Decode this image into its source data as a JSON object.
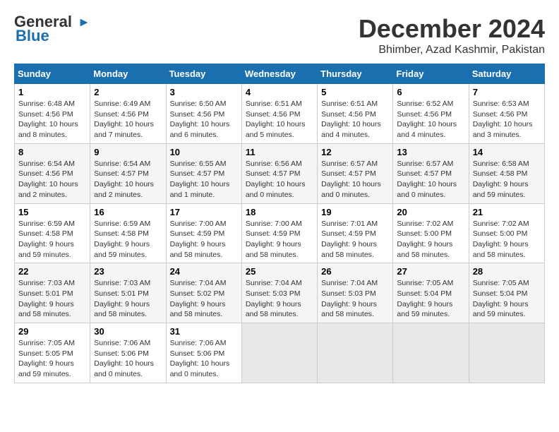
{
  "logo": {
    "line1": "General",
    "line2": "Blue"
  },
  "title": {
    "month": "December 2024",
    "location": "Bhimber, Azad Kashmir, Pakistan"
  },
  "weekdays": [
    "Sunday",
    "Monday",
    "Tuesday",
    "Wednesday",
    "Thursday",
    "Friday",
    "Saturday"
  ],
  "weeks": [
    [
      {
        "day": "1",
        "sunrise": "6:48 AM",
        "sunset": "4:56 PM",
        "daylight": "10 hours and 8 minutes."
      },
      {
        "day": "2",
        "sunrise": "6:49 AM",
        "sunset": "4:56 PM",
        "daylight": "10 hours and 7 minutes."
      },
      {
        "day": "3",
        "sunrise": "6:50 AM",
        "sunset": "4:56 PM",
        "daylight": "10 hours and 6 minutes."
      },
      {
        "day": "4",
        "sunrise": "6:51 AM",
        "sunset": "4:56 PM",
        "daylight": "10 hours and 5 minutes."
      },
      {
        "day": "5",
        "sunrise": "6:51 AM",
        "sunset": "4:56 PM",
        "daylight": "10 hours and 4 minutes."
      },
      {
        "day": "6",
        "sunrise": "6:52 AM",
        "sunset": "4:56 PM",
        "daylight": "10 hours and 4 minutes."
      },
      {
        "day": "7",
        "sunrise": "6:53 AM",
        "sunset": "4:56 PM",
        "daylight": "10 hours and 3 minutes."
      }
    ],
    [
      {
        "day": "8",
        "sunrise": "6:54 AM",
        "sunset": "4:56 PM",
        "daylight": "10 hours and 2 minutes."
      },
      {
        "day": "9",
        "sunrise": "6:54 AM",
        "sunset": "4:57 PM",
        "daylight": "10 hours and 2 minutes."
      },
      {
        "day": "10",
        "sunrise": "6:55 AM",
        "sunset": "4:57 PM",
        "daylight": "10 hours and 1 minute."
      },
      {
        "day": "11",
        "sunrise": "6:56 AM",
        "sunset": "4:57 PM",
        "daylight": "10 hours and 0 minutes."
      },
      {
        "day": "12",
        "sunrise": "6:57 AM",
        "sunset": "4:57 PM",
        "daylight": "10 hours and 0 minutes."
      },
      {
        "day": "13",
        "sunrise": "6:57 AM",
        "sunset": "4:57 PM",
        "daylight": "10 hours and 0 minutes."
      },
      {
        "day": "14",
        "sunrise": "6:58 AM",
        "sunset": "4:58 PM",
        "daylight": "9 hours and 59 minutes."
      }
    ],
    [
      {
        "day": "15",
        "sunrise": "6:59 AM",
        "sunset": "4:58 PM",
        "daylight": "9 hours and 59 minutes."
      },
      {
        "day": "16",
        "sunrise": "6:59 AM",
        "sunset": "4:58 PM",
        "daylight": "9 hours and 59 minutes."
      },
      {
        "day": "17",
        "sunrise": "7:00 AM",
        "sunset": "4:59 PM",
        "daylight": "9 hours and 58 minutes."
      },
      {
        "day": "18",
        "sunrise": "7:00 AM",
        "sunset": "4:59 PM",
        "daylight": "9 hours and 58 minutes."
      },
      {
        "day": "19",
        "sunrise": "7:01 AM",
        "sunset": "4:59 PM",
        "daylight": "9 hours and 58 minutes."
      },
      {
        "day": "20",
        "sunrise": "7:02 AM",
        "sunset": "5:00 PM",
        "daylight": "9 hours and 58 minutes."
      },
      {
        "day": "21",
        "sunrise": "7:02 AM",
        "sunset": "5:00 PM",
        "daylight": "9 hours and 58 minutes."
      }
    ],
    [
      {
        "day": "22",
        "sunrise": "7:03 AM",
        "sunset": "5:01 PM",
        "daylight": "9 hours and 58 minutes."
      },
      {
        "day": "23",
        "sunrise": "7:03 AM",
        "sunset": "5:01 PM",
        "daylight": "9 hours and 58 minutes."
      },
      {
        "day": "24",
        "sunrise": "7:04 AM",
        "sunset": "5:02 PM",
        "daylight": "9 hours and 58 minutes."
      },
      {
        "day": "25",
        "sunrise": "7:04 AM",
        "sunset": "5:03 PM",
        "daylight": "9 hours and 58 minutes."
      },
      {
        "day": "26",
        "sunrise": "7:04 AM",
        "sunset": "5:03 PM",
        "daylight": "9 hours and 58 minutes."
      },
      {
        "day": "27",
        "sunrise": "7:05 AM",
        "sunset": "5:04 PM",
        "daylight": "9 hours and 59 minutes."
      },
      {
        "day": "28",
        "sunrise": "7:05 AM",
        "sunset": "5:04 PM",
        "daylight": "9 hours and 59 minutes."
      }
    ],
    [
      {
        "day": "29",
        "sunrise": "7:05 AM",
        "sunset": "5:05 PM",
        "daylight": "9 hours and 59 minutes."
      },
      {
        "day": "30",
        "sunrise": "7:06 AM",
        "sunset": "5:06 PM",
        "daylight": "10 hours and 0 minutes."
      },
      {
        "day": "31",
        "sunrise": "7:06 AM",
        "sunset": "5:06 PM",
        "daylight": "10 hours and 0 minutes."
      },
      null,
      null,
      null,
      null
    ]
  ]
}
